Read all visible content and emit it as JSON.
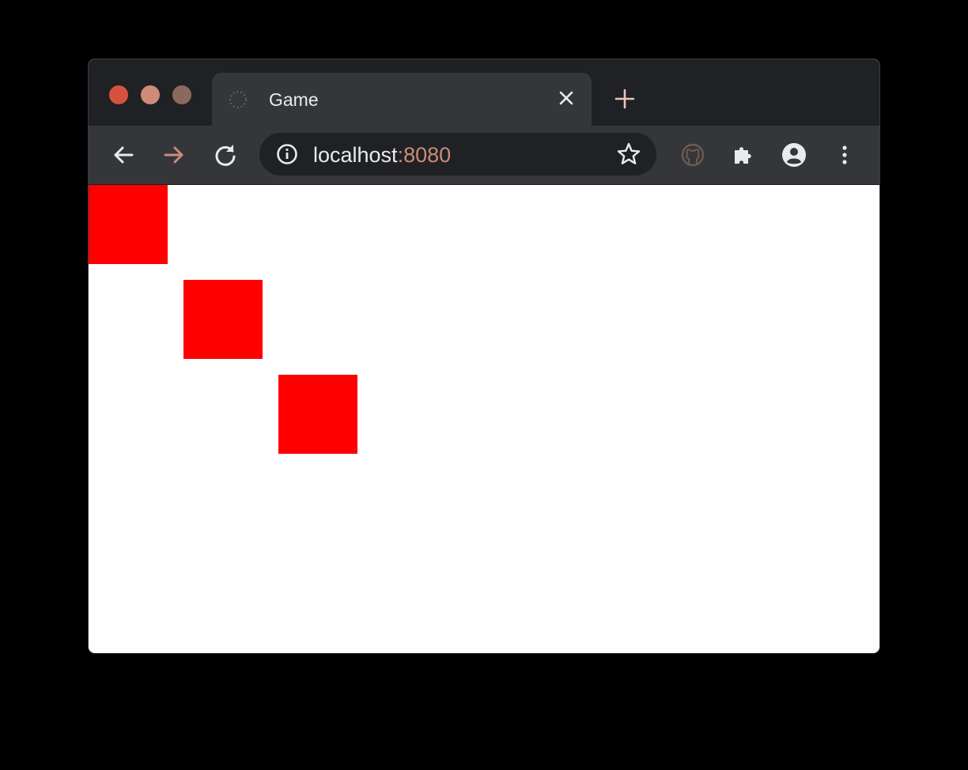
{
  "window": {
    "traffic_lights": [
      "close",
      "minimize",
      "zoom"
    ]
  },
  "tab": {
    "title": "Game",
    "favicon": "loading-spinner-icon",
    "close_icon": "close-icon"
  },
  "new_tab_icon": "plus-icon",
  "toolbar": {
    "back_icon": "arrow-left-icon",
    "forward_icon": "arrow-right-icon",
    "reload_icon": "reload-icon",
    "site_info_icon": "info-icon",
    "bookmark_icon": "star-icon",
    "extension_github_icon": "github-icon",
    "extensions_icon": "puzzle-icon",
    "profile_icon": "account-circle-icon",
    "menu_icon": "kebab-menu-icon"
  },
  "address_bar": {
    "host": "localhost",
    "port": ":8080"
  },
  "game": {
    "squares": [
      {
        "color": "#ff0000"
      },
      {
        "color": "#ff0000"
      },
      {
        "color": "#ff0000"
      }
    ]
  },
  "colors": {
    "titlebar": "#202124",
    "toolbar": "#35363a",
    "omnibox": "#202124",
    "accent_port": "#c98c79",
    "square": "#ff0000",
    "page_bg": "#ffffff"
  }
}
